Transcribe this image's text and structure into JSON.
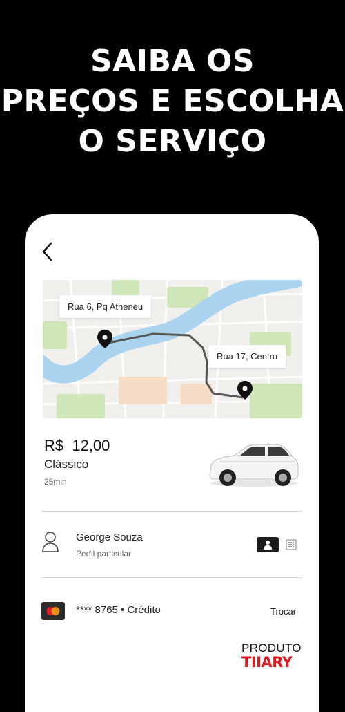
{
  "headline": {
    "line1": "SAIBA OS",
    "line2": "PREÇOS E ESCOLHA",
    "line3": "O SERVIÇO"
  },
  "map": {
    "origin_label": "Rua 6, Pq Atheneu",
    "destination_label": "Rua 17, Centro"
  },
  "ride": {
    "price": "R$  12,00",
    "category": "Clássico",
    "duration": "25min"
  },
  "profile": {
    "name": "George Souza",
    "type": "Perfil particular"
  },
  "payment": {
    "card": "**** 8765 • Crédito",
    "change_label": "Trocar"
  },
  "brand": {
    "top": "PRODUTO",
    "logo": "TIIARY"
  },
  "colors": {
    "background": "#000000",
    "river": "#a9d3ee",
    "parks": "#cfe6b8",
    "route": "#555555",
    "brand_red": "#e0171c"
  },
  "icons": {
    "back": "chevron-left-icon",
    "pin": "map-pin-icon",
    "person": "person-outline-icon",
    "personal_toggle": "person-filled-icon",
    "business_toggle": "building-icon",
    "card": "mastercard-icon"
  }
}
